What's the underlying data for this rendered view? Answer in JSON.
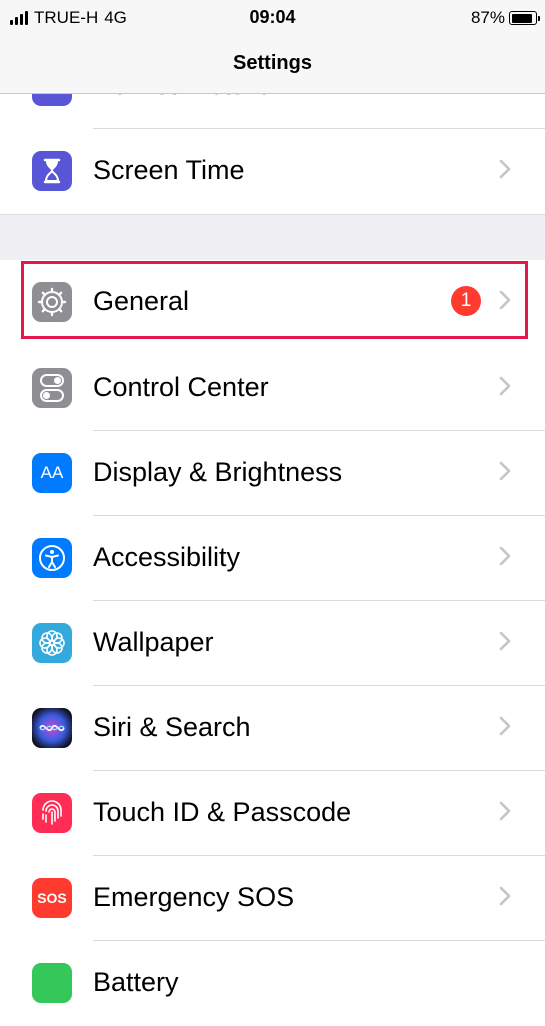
{
  "status_bar": {
    "carrier": "TRUE-H",
    "network": "4G",
    "time": "09:04",
    "battery": "87%"
  },
  "nav": {
    "title": "Settings"
  },
  "rows": [
    {
      "label": "Do Not Disturb",
      "icon": "moon-icon",
      "color": "#5856d6"
    },
    {
      "label": "Screen Time",
      "icon": "hourglass-icon",
      "color": "#5856d6"
    },
    {
      "label": "General",
      "icon": "gear-icon",
      "color": "#8e8e93",
      "badge": "1"
    },
    {
      "label": "Control Center",
      "icon": "toggles-icon",
      "color": "#8e8e93"
    },
    {
      "label": "Display & Brightness",
      "icon": "text-size-icon",
      "color": "#007aff",
      "icon_text": "AA"
    },
    {
      "label": "Accessibility",
      "icon": "accessibility-icon",
      "color": "#007aff"
    },
    {
      "label": "Wallpaper",
      "icon": "flower-icon",
      "color": "#34aadc"
    },
    {
      "label": "Siri & Search",
      "icon": "siri-icon",
      "color": "#1c1c2e"
    },
    {
      "label": "Touch ID & Passcode",
      "icon": "fingerprint-icon",
      "color": "#ff2d55"
    },
    {
      "label": "Emergency SOS",
      "icon": "sos-icon",
      "color": "#ff3b30",
      "icon_text": "SOS"
    },
    {
      "label": "Battery",
      "icon": "battery-icon",
      "color": "#34c759"
    }
  ]
}
